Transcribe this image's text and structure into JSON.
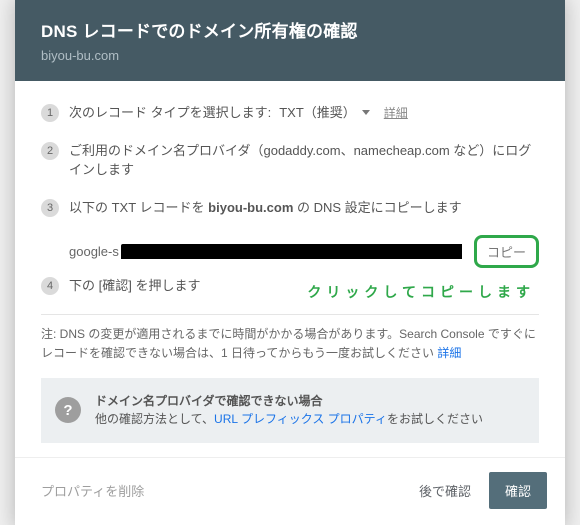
{
  "header": {
    "title": "DNS レコードでのドメイン所有権の確認",
    "subtitle": "biyou-bu.com"
  },
  "steps": {
    "s1": {
      "num": "1",
      "label": "次のレコード タイプを選択します:",
      "select_value": "TXT（推奨）",
      "detail": "詳細"
    },
    "s2": {
      "num": "2",
      "text": "ご利用のドメイン名プロバイダ（godaddy.com、namecheap.com など）にログインします"
    },
    "s3": {
      "num": "3",
      "text_a": "以下の TXT レコードを ",
      "domain": "biyou-bu.com",
      "text_b": " の DNS 設定にコピーします"
    },
    "s4": {
      "num": "4",
      "text": "下の [確認] を押します"
    }
  },
  "record": {
    "prefix": "google-s",
    "copy_label": "コピー"
  },
  "callout": "クリックしてコピーします",
  "note": {
    "text": "注: DNS の変更が適用されるまでに時間がかかる場合があります。Search Console ですぐにレコードを確認できない場合は、1 日待ってからもう一度お試しください ",
    "link": "詳細"
  },
  "info": {
    "icon_glyph": "?",
    "title": "ドメイン名プロバイダで確認できない場合",
    "body_a": "他の確認方法として、",
    "link": "URL プレフィックス プロパティ",
    "body_b": "をお試しください"
  },
  "footer": {
    "delete": "プロパティを削除",
    "later": "後で確認",
    "confirm": "確認"
  }
}
